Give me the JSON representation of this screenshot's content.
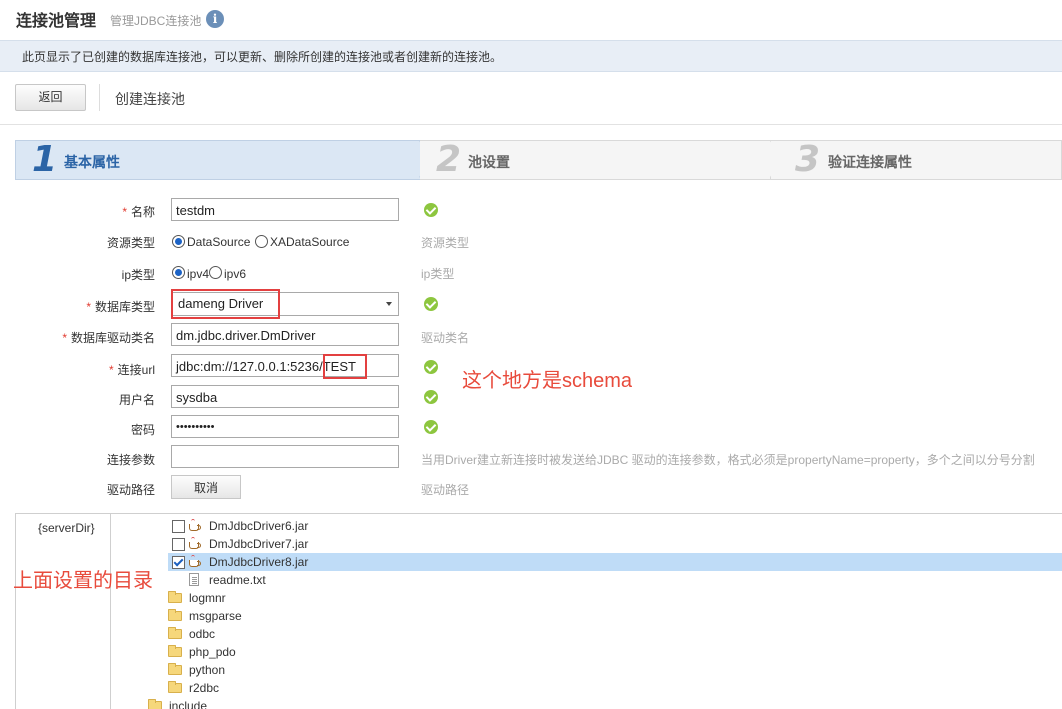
{
  "header": {
    "title": "连接池管理",
    "subtitle": "管理JDBC连接池",
    "info_icon": "i"
  },
  "description": "此页显示了已创建的数据库连接池，可以更新、删除所创建的连接池或者创建新的连接池。",
  "toolbar": {
    "back_label": "返回",
    "section_title": "创建连接池"
  },
  "steps": [
    {
      "number": "1",
      "label": "基本属性",
      "active": true
    },
    {
      "number": "2",
      "label": "池设置",
      "active": false
    },
    {
      "number": "3",
      "label": "验证连接属性",
      "active": false
    }
  ],
  "form": {
    "required_mark": "*",
    "name": {
      "label": "名称",
      "value": "testdm"
    },
    "resource_type": {
      "label": "资源类型",
      "options": [
        "DataSource",
        "XADataSource"
      ],
      "selected": "DataSource",
      "hint": "资源类型"
    },
    "ip_type": {
      "label": "ip类型",
      "options": [
        "ipv4",
        "ipv6"
      ],
      "selected": "ipv4",
      "hint": "ip类型"
    },
    "db_type": {
      "label": "数据库类型",
      "value": "dameng Driver"
    },
    "driver_class": {
      "label": "数据库驱动类名",
      "value": "dm.jdbc.driver.DmDriver",
      "hint": "驱动类名"
    },
    "url": {
      "label": "连接url",
      "value_prefix": "jdbc:dm://127.0.0.1:5236/",
      "value_schema": "TEST"
    },
    "username": {
      "label": "用户名",
      "value": "sysdba"
    },
    "password": {
      "label": "密码",
      "value": "••••••••••"
    },
    "conn_params": {
      "label": "连接参数",
      "value": "",
      "hint": "当用Driver建立新连接时被发送给JDBC 驱动的连接参数，格式必须是propertyName=property，多个之间以分号分割"
    },
    "driver_path": {
      "label": "驱动路径",
      "cancel_label": "取消",
      "hint": "驱动路径"
    }
  },
  "annotations": {
    "schema_note": "这个地方是schema",
    "dir_note": "上面设置的目录"
  },
  "tree": {
    "root_label": "{serverDir}",
    "files": [
      {
        "name": "DmJdbcDriver6.jar",
        "checked": false,
        "selected": false
      },
      {
        "name": "DmJdbcDriver7.jar",
        "checked": false,
        "selected": false
      },
      {
        "name": "DmJdbcDriver8.jar",
        "checked": true,
        "selected": true
      }
    ],
    "readme": "readme.txt",
    "folders": [
      "logmnr",
      "msgparse",
      "odbc",
      "php_pdo",
      "python",
      "r2dbc"
    ],
    "parent_folder": "include"
  },
  "colors": {
    "accent": "#2b64a6",
    "required": "#e13b30",
    "annotation": "#e84b3c",
    "ok": "#8dc63f",
    "selected_row": "#bfdcf7"
  }
}
